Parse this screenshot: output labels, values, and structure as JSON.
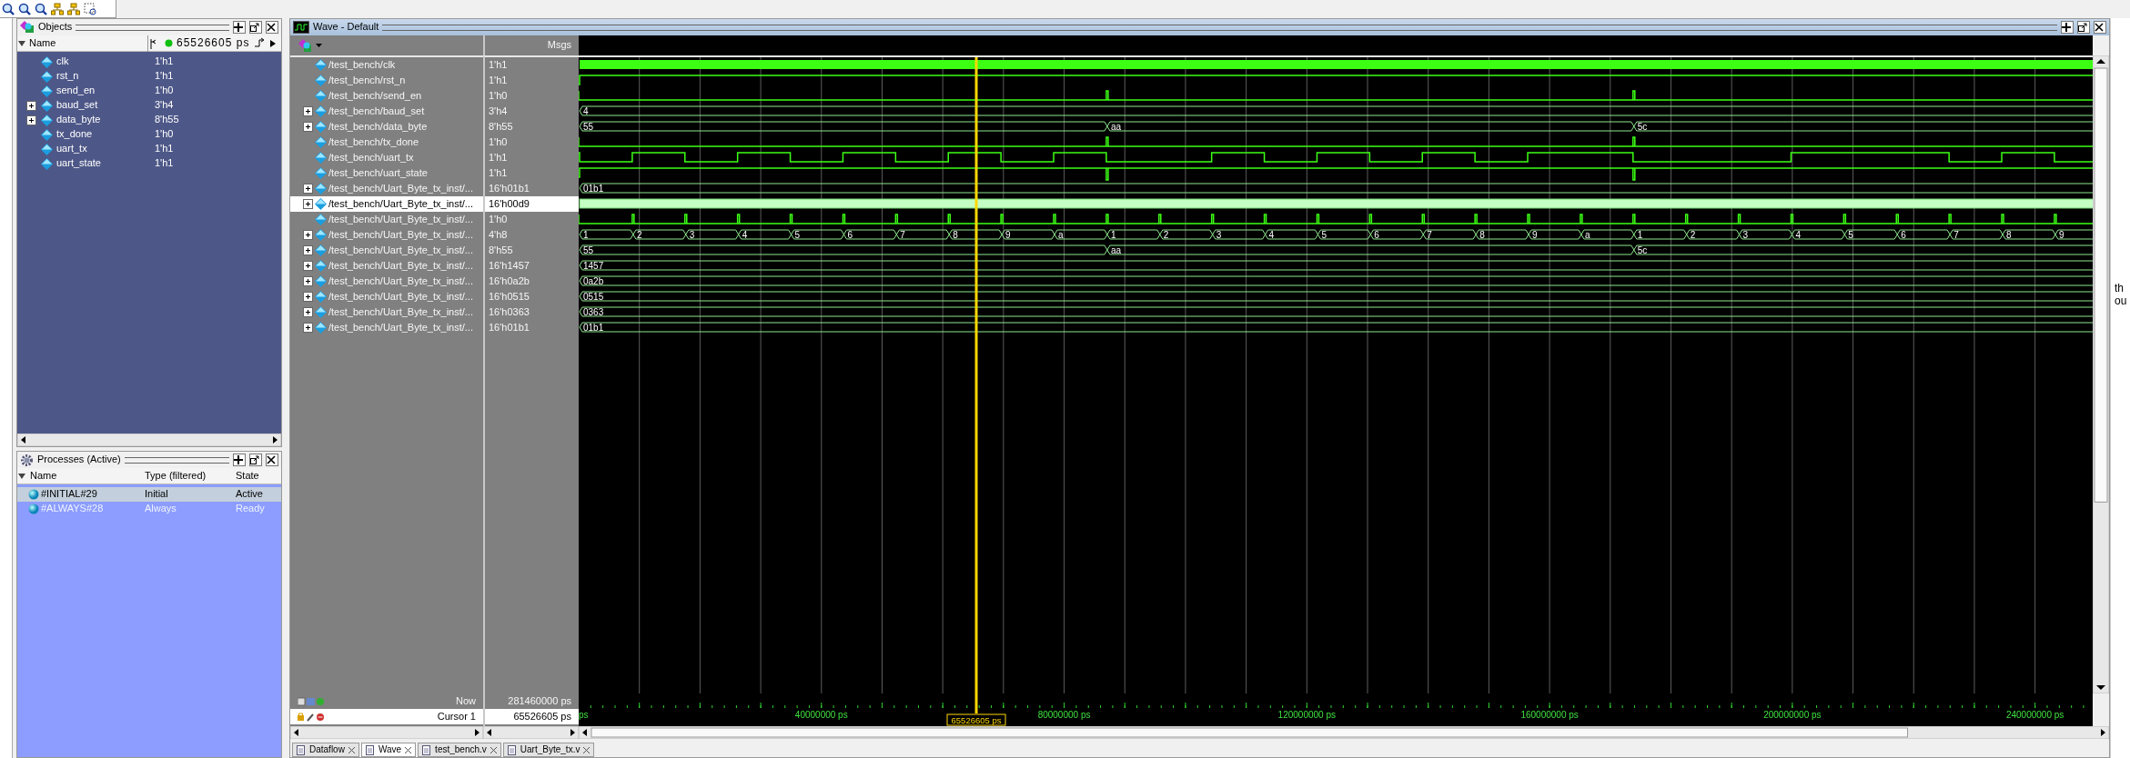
{
  "objects": {
    "title": "Objects",
    "column": "Name",
    "time": "65526605 ps",
    "items": [
      {
        "name": "clk",
        "value": "1'h1",
        "expandable": false
      },
      {
        "name": "rst_n",
        "value": "1'h1",
        "expandable": false
      },
      {
        "name": "send_en",
        "value": "1'h0",
        "expandable": false
      },
      {
        "name": "baud_set",
        "value": "3'h4",
        "expandable": true
      },
      {
        "name": "data_byte",
        "value": "8'h55",
        "expandable": true
      },
      {
        "name": "tx_done",
        "value": "1'h0",
        "expandable": false
      },
      {
        "name": "uart_tx",
        "value": "1'h1",
        "expandable": false
      },
      {
        "name": "uart_state",
        "value": "1'h1",
        "expandable": false
      }
    ]
  },
  "processes": {
    "title": "Processes (Active)",
    "columns": [
      "Name",
      "Type (filtered)",
      "State"
    ],
    "items": [
      {
        "name": "#INITIAL#29",
        "type": "Initial",
        "state": "Active",
        "selected": true
      },
      {
        "name": "#ALWAYS#28",
        "type": "Always",
        "state": "Ready",
        "selected": false
      }
    ]
  },
  "wave": {
    "title": "Wave - Default",
    "msgs_label": "Msgs",
    "signals": [
      {
        "name": "/test_bench/clk",
        "value": "1'h1",
        "expandable": false,
        "selected": false,
        "kind": "clock"
      },
      {
        "name": "/test_bench/rst_n",
        "value": "1'h1",
        "expandable": false,
        "selected": false,
        "kind": "high",
        "pulses": false
      },
      {
        "name": "/test_bench/send_en",
        "value": "1'h0",
        "expandable": false,
        "selected": false,
        "kind": "low",
        "pulses": true
      },
      {
        "name": "/test_bench/baud_set",
        "value": "3'h4",
        "expandable": true,
        "selected": false,
        "kind": "bus",
        "frames": [
          [
            "4"
          ]
        ]
      },
      {
        "name": "/test_bench/data_byte",
        "value": "8'h55",
        "expandable": true,
        "selected": false,
        "kind": "bytes",
        "frames": [
          [
            "55"
          ],
          [
            "aa"
          ],
          [
            "5c"
          ]
        ]
      },
      {
        "name": "/test_bench/tx_done",
        "value": "1'h0",
        "expandable": false,
        "selected": false,
        "kind": "low",
        "pulses": true
      },
      {
        "name": "/test_bench/uart_tx",
        "value": "1'h1",
        "expandable": false,
        "selected": false,
        "kind": "serial"
      },
      {
        "name": "/test_bench/uart_state",
        "value": "1'h1",
        "expandable": false,
        "selected": false,
        "kind": "high",
        "pulses": true
      },
      {
        "name": "/test_bench/Uart_Byte_tx_inst/...",
        "value": "16'h01b1",
        "expandable": true,
        "selected": false,
        "kind": "bus",
        "frames": [
          [
            "01b1"
          ]
        ]
      },
      {
        "name": "/test_bench/Uart_Byte_tx_inst/...",
        "value": "16'h00d9",
        "expandable": true,
        "selected": true,
        "kind": "dense"
      },
      {
        "name": "/test_bench/Uart_Byte_tx_inst/...",
        "value": "1'h0",
        "expandable": false,
        "selected": false,
        "kind": "tick"
      },
      {
        "name": "/test_bench/Uart_Byte_tx_inst/...",
        "value": "4'h8",
        "expandable": true,
        "selected": false,
        "kind": "bus",
        "frames": [
          [
            "1",
            "2",
            "3",
            "4",
            "5",
            "6",
            "7",
            "8",
            "9",
            "a"
          ],
          [
            "1",
            "2",
            "3",
            "4",
            "5",
            "6",
            "7",
            "8",
            "9",
            "a"
          ],
          [
            "1",
            "2",
            "3",
            "4",
            "5",
            "6",
            "7",
            "8",
            "9"
          ]
        ]
      },
      {
        "name": "/test_bench/Uart_Byte_tx_inst/...",
        "value": "8'h55",
        "expandable": true,
        "selected": false,
        "kind": "bus",
        "frames": [
          [
            "55"
          ],
          [
            "aa"
          ],
          [
            "5c"
          ]
        ]
      },
      {
        "name": "/test_bench/Uart_Byte_tx_inst/...",
        "value": "16'h1457",
        "expandable": true,
        "selected": false,
        "kind": "bus",
        "frames": [
          [
            "1457"
          ]
        ]
      },
      {
        "name": "/test_bench/Uart_Byte_tx_inst/...",
        "value": "16'h0a2b",
        "expandable": true,
        "selected": false,
        "kind": "bus",
        "frames": [
          [
            "0a2b"
          ]
        ]
      },
      {
        "name": "/test_bench/Uart_Byte_tx_inst/...",
        "value": "16'h0515",
        "expandable": true,
        "selected": false,
        "kind": "bus",
        "frames": [
          [
            "0515"
          ]
        ]
      },
      {
        "name": "/test_bench/Uart_Byte_tx_inst/...",
        "value": "16'h0363",
        "expandable": true,
        "selected": false,
        "kind": "bus",
        "frames": [
          [
            "0363"
          ]
        ]
      },
      {
        "name": "/test_bench/Uart_Byte_tx_inst/...",
        "value": "16'h01b1",
        "expandable": true,
        "selected": false,
        "kind": "bus",
        "frames": [
          [
            "01b1"
          ]
        ]
      }
    ],
    "now_label": "Now",
    "now": "281460000 ps",
    "cursor_label": "Cursor 1",
    "cursor": "65526605 ps",
    "ruler": [
      "ps",
      "40000000 ps",
      "80000000 ps",
      "120000000 ps",
      "160000000 ps",
      "200000000 ps",
      "240000000 ps"
    ],
    "cursor_flag": "65526605 ps"
  },
  "tabs": [
    {
      "label": "Dataflow",
      "selected": false
    },
    {
      "label": "Wave",
      "selected": true
    },
    {
      "label": "test_bench.v",
      "selected": false
    },
    {
      "label": "Uart_Byte_tx.v",
      "selected": false
    }
  ],
  "side_text": [
    "th",
    "ou"
  ]
}
